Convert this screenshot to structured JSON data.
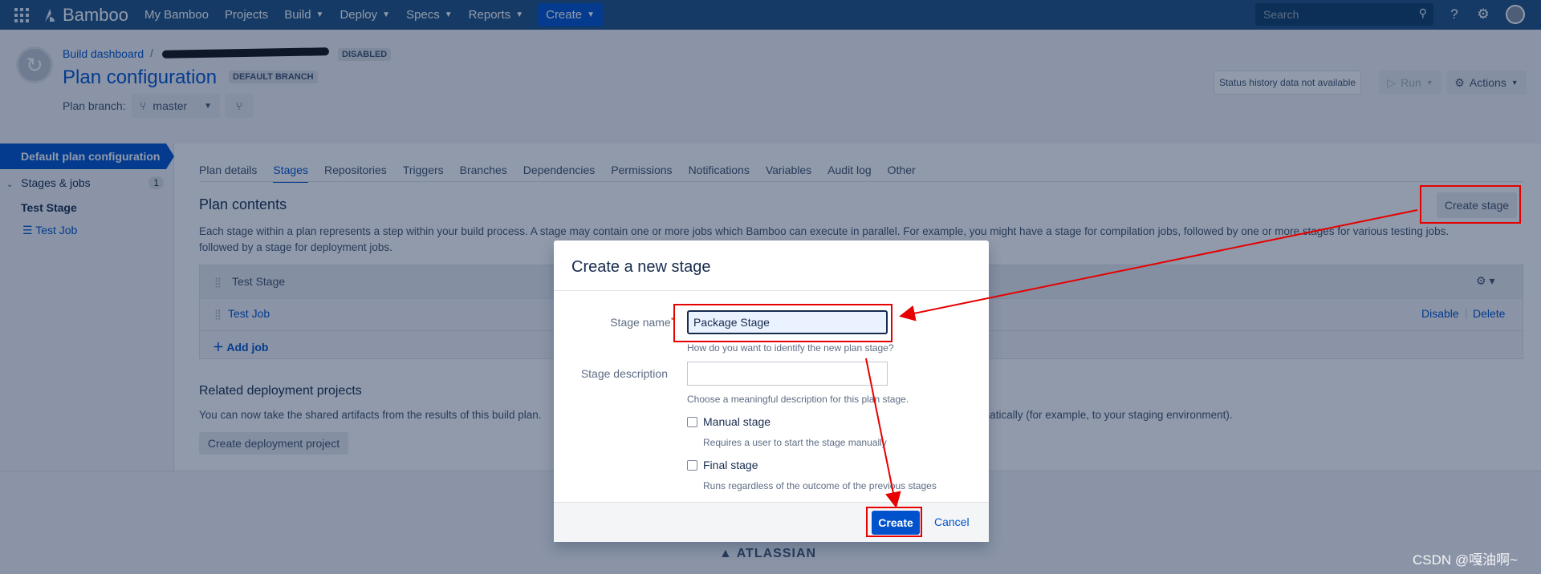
{
  "topnav": {
    "brand": "Bamboo",
    "items": [
      {
        "label": "My Bamboo",
        "dropdown": false
      },
      {
        "label": "Projects",
        "dropdown": false
      },
      {
        "label": "Build",
        "dropdown": true
      },
      {
        "label": "Deploy",
        "dropdown": true
      },
      {
        "label": "Specs",
        "dropdown": true
      },
      {
        "label": "Reports",
        "dropdown": true
      }
    ],
    "create_label": "Create",
    "search_placeholder": "Search"
  },
  "header": {
    "breadcrumb": "Build dashboard",
    "breadcrumb_sep": "/",
    "disabled_badge": "DISABLED",
    "title": "Plan configuration",
    "default_branch_badge": "DEFAULT BRANCH",
    "plan_branch_label": "Plan branch:",
    "branch_value": "master",
    "status_history": "Status history data not available",
    "run_label": "Run",
    "actions_label": "Actions"
  },
  "sidebar": {
    "heading": "Default plan configuration",
    "stages_jobs_label": "Stages & jobs",
    "stages_jobs_count": "1",
    "stage_name": "Test Stage",
    "job_name": "Test Job"
  },
  "tabs": [
    "Plan details",
    "Stages",
    "Repositories",
    "Triggers",
    "Branches",
    "Dependencies",
    "Permissions",
    "Notifications",
    "Variables",
    "Audit log",
    "Other"
  ],
  "active_tab": "Stages",
  "content": {
    "plan_contents_title": "Plan contents",
    "create_stage_label": "Create stage",
    "description_line1": "Each stage within a plan represents a step within your build process. A stage may contain one or more jobs which Bamboo can execute in parallel. For example, you might have a stage for compilation jobs, followed by one or more stages for various testing jobs.",
    "description_line2": "followed by a stage for deployment jobs.",
    "stage_row_name": "Test Stage",
    "job_row_name": "Test Job",
    "disable_label": "Disable",
    "delete_label": "Delete",
    "add_job_label": "Add job",
    "related_title": "Related deployment projects",
    "related_text_left": "You can now take the shared artifacts from the results of this build plan.",
    "related_text_right": "matically (for example, to your staging environment).",
    "create_deployment_label": "Create deployment project"
  },
  "footer": {
    "atlassian": "ATLASSIAN",
    "watermark": "CSDN @嘎油啊~"
  },
  "dialog": {
    "title": "Create a new stage",
    "stage_name_label": "Stage name",
    "stage_name_value": "Package Stage",
    "stage_name_help": "How do you want to identify the new plan stage?",
    "stage_desc_label": "Stage description",
    "stage_desc_value": "",
    "stage_desc_help": "Choose a meaningful description for this plan stage.",
    "manual_label": "Manual stage",
    "manual_help": "Requires a user to start the stage manually",
    "final_label": "Final stage",
    "final_help": "Runs regardless of the outcome of the previous stages",
    "create_button": "Create",
    "cancel_button": "Cancel"
  },
  "colors": {
    "nav_bg": "#205081",
    "accent": "#0052cc",
    "annotation_red": "#e60000"
  }
}
